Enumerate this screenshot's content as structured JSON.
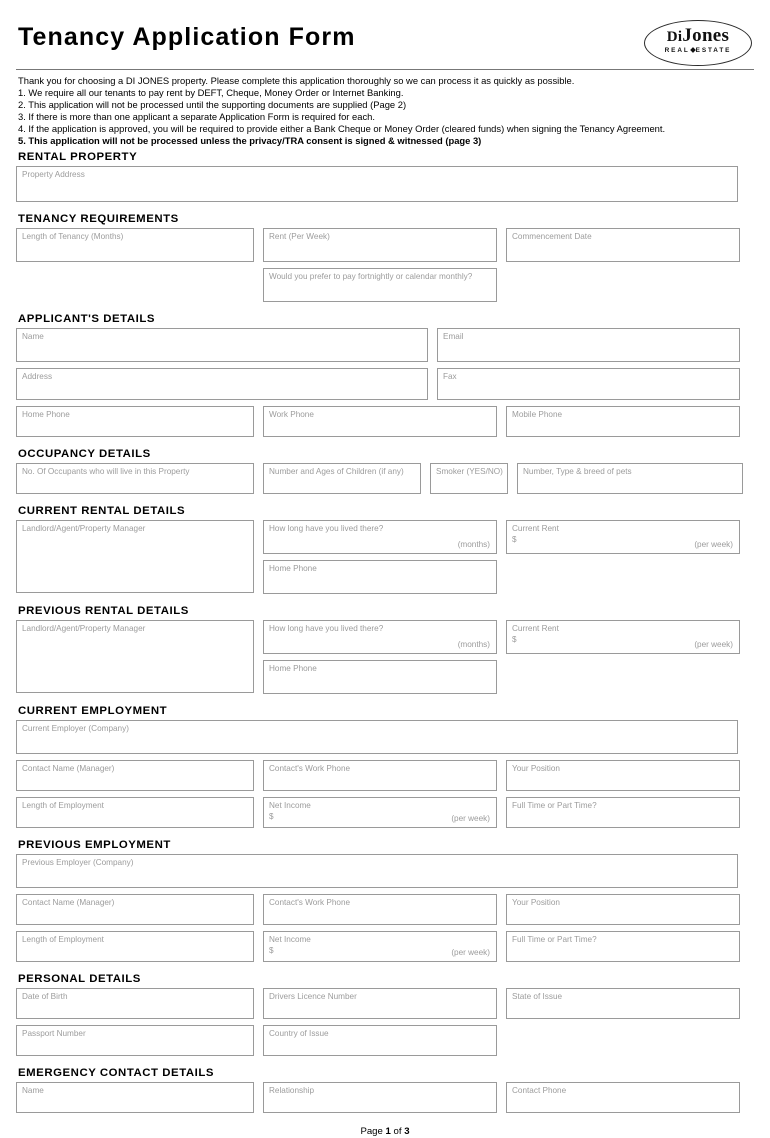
{
  "header": {
    "title": "Tenancy Application Form",
    "logo": {
      "name_part1": "Di",
      "name_part2": "Jones",
      "tagline_left": "REAL",
      "tagline_right": "ESTATE"
    }
  },
  "intro": {
    "lines": [
      {
        "text": "Thank you for choosing a DI JONES property. Please complete this application thoroughly so we can process it as quickly as possible.",
        "bold": false
      },
      {
        "text": "1. We require all our tenants to pay rent by DEFT, Cheque, Money Order or Internet Banking.",
        "bold": false
      },
      {
        "text": "2. This application will not be processed until the supporting documents are supplied (Page 2)",
        "bold": false
      },
      {
        "text": "3. If there is more than one applicant a separate Application Form is required for each.",
        "bold": false
      },
      {
        "text": "4. If the application is approved, you will be required to provide either a Bank Cheque or Money Order (cleared funds) when signing the Tenancy Agreement.",
        "bold": false
      },
      {
        "text": "5. This application will not be processed unless the privacy/TRA consent is signed & witnessed (page 3)",
        "bold": true
      }
    ]
  },
  "sections": {
    "rental_property": {
      "heading": "RENTAL PROPERTY",
      "property_address": "Property Address"
    },
    "tenancy_requirements": {
      "heading": "TENANCY REQUIREMENTS",
      "length_of_tenancy": "Length of Tenancy (Months)",
      "rent_per_week": "Rent (Per Week)",
      "commencement_date": "Commencement Date",
      "payment_preference": "Would you prefer to pay fortnightly or calendar monthly?"
    },
    "applicants_details": {
      "heading": "APPLICANT'S DETAILS",
      "name": "Name",
      "email": "Email",
      "address": "Address",
      "fax": "Fax",
      "home_phone": "Home Phone",
      "work_phone": "Work Phone",
      "mobile_phone": "Mobile Phone"
    },
    "occupancy_details": {
      "heading": "OCCUPANCY DETAILS",
      "occupants": "No. Of Occupants who will live in this Property",
      "children": "Number and Ages of Children (if any)",
      "smoker": "Smoker (YES/NO)",
      "pets": "Number, Type & breed of pets"
    },
    "current_rental_details": {
      "heading": "CURRENT RENTAL DETAILS",
      "landlord": "Landlord/Agent/Property Manager",
      "how_long": "How long have you lived there?",
      "how_long_suffix": "(months)",
      "current_rent": "Current Rent",
      "currency_symbol": "$",
      "rent_suffix": "(per week)",
      "home_phone": "Home Phone"
    },
    "previous_rental_details": {
      "heading": "PREVIOUS RENTAL DETAILS",
      "landlord": "Landlord/Agent/Property Manager",
      "how_long": "How long have you lived there?",
      "how_long_suffix": "(months)",
      "current_rent": "Current Rent",
      "currency_symbol": "$",
      "rent_suffix": "(per week)",
      "home_phone": "Home Phone"
    },
    "current_employment": {
      "heading": "CURRENT EMPLOYMENT",
      "employer": "Current Employer (Company)",
      "contact_name": "Contact Name (Manager)",
      "contact_phone": "Contact's Work Phone",
      "position": "Your Position",
      "length_of_employment": "Length of Employment",
      "net_income": "Net Income",
      "currency_symbol": "$",
      "income_suffix": "(per week)",
      "full_or_part": "Full Time or Part Time?"
    },
    "previous_employment": {
      "heading": "PREVIOUS EMPLOYMENT",
      "employer": "Previous Employer (Company)",
      "contact_name": "Contact Name (Manager)",
      "contact_phone": "Contact's Work Phone",
      "position": "Your Position",
      "length_of_employment": "Length of Employment",
      "net_income": "Net Income",
      "currency_symbol": "$",
      "income_suffix": "(per week)",
      "full_or_part": "Full Time or Part Time?"
    },
    "personal_details": {
      "heading": "PERSONAL DETAILS",
      "date_of_birth": "Date of Birth",
      "drivers_licence": "Drivers Licence Number",
      "state_of_issue": "State of Issue",
      "passport_number": "Passport Number",
      "country_of_issue": "Country of Issue"
    },
    "emergency_contact_details": {
      "heading": "EMERGENCY CONTACT DETAILS",
      "name": "Name",
      "relationship": "Relationship",
      "contact_phone": "Contact Phone"
    }
  },
  "footer": {
    "prefix": "Page ",
    "current": "1",
    "middle": " of ",
    "total": "3"
  }
}
